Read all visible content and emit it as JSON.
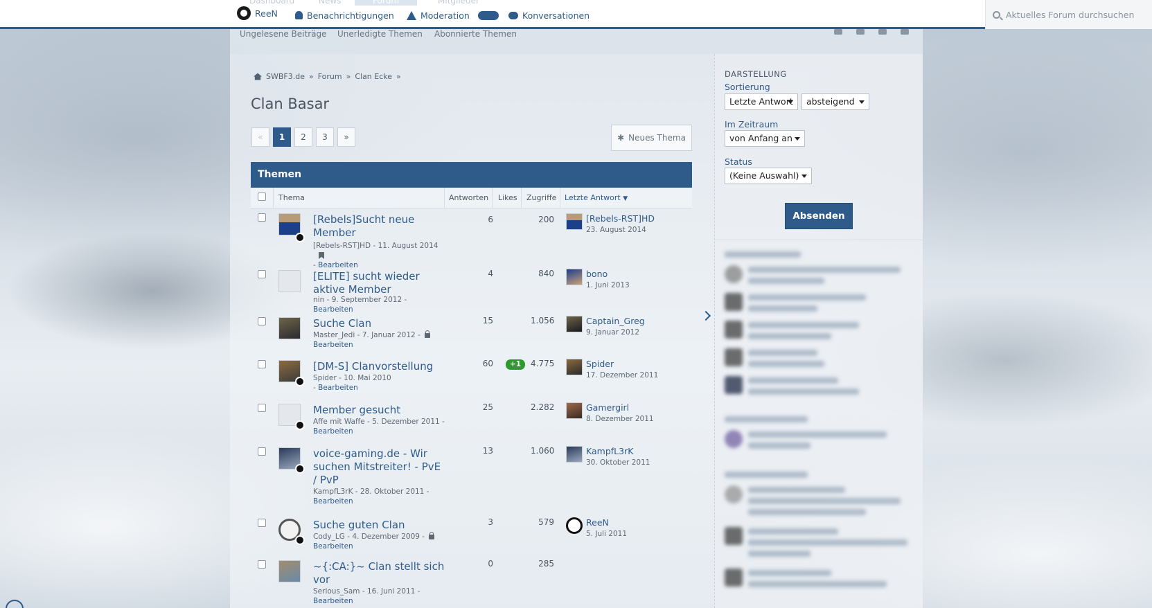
{
  "topbar": {
    "ghost_tabs": [
      "Dashboard",
      "News",
      "Forum",
      "Mitglieder"
    ],
    "user_name": "ReeN",
    "notifications_label": "Benachrichtigungen",
    "moderation_label": "Moderation",
    "conversations_label": "Konversationen",
    "search_placeholder": "Aktuelles Forum durchsuchen"
  },
  "subnav": {
    "links": [
      "Ungelesene Beiträge",
      "Unerledigte Themen",
      "Abonnierte Themen"
    ]
  },
  "breadcrumb": [
    "SWBF3.de",
    "Forum",
    "Clan Ecke"
  ],
  "page_title": "Clan Basar",
  "pager": {
    "prev": "«",
    "pages": [
      "1",
      "2",
      "3"
    ],
    "next": "»",
    "current": "1"
  },
  "new_thread_label": "Neues Thema",
  "panel_title": "Themen",
  "columns": {
    "topic": "Thema",
    "replies": "Antworten",
    "likes": "Likes",
    "views": "Zugriffe",
    "last_reply": "Letzte Antwort"
  },
  "threads": [
    {
      "title": "[Rebels]Sucht neue Member",
      "author": "[Rebels-RST]HD",
      "date": "11. August 2014",
      "edit": "Bearbeiten",
      "replies": "6",
      "likes": "",
      "views": "200",
      "last_user": "[Rebels-RST]HD",
      "last_date": "23. August 2014"
    },
    {
      "title": "[ELITE] sucht wieder aktive Member",
      "author": "nin",
      "date": "9. September 2012",
      "edit": "Bearbeiten",
      "replies": "4",
      "likes": "",
      "views": "840",
      "last_user": "bono",
      "last_date": "1. Juni 2013"
    },
    {
      "title": "Suche Clan",
      "author": "Master_Jedi",
      "date": "7. Januar 2012",
      "edit": "Bearbeiten",
      "replies": "15",
      "likes": "",
      "views": "1.056",
      "last_user": "Captain_Greg",
      "last_date": "9. Januar 2012"
    },
    {
      "title": "[DM-S] Clanvorstellung",
      "author": "Spider",
      "date": "10. Mai 2010",
      "edit": "Bearbeiten",
      "replies": "60",
      "likes": "+1",
      "views": "4.775",
      "last_user": "Spider",
      "last_date": "17. Dezember 2011"
    },
    {
      "title": "Member gesucht",
      "author": "Affe mit Waffe",
      "date": "5. Dezember 2011",
      "edit": "Bearbeiten",
      "replies": "25",
      "likes": "",
      "views": "2.282",
      "last_user": "Gamergirl",
      "last_date": "8. Dezember 2011"
    },
    {
      "title": "voice-gaming.de - Wir suchen Mitstreiter! - PvE / PvP",
      "author": "KampfL3rK",
      "date": "28. Oktober 2011",
      "edit": "Bearbeiten",
      "replies": "13",
      "likes": "",
      "views": "1.060",
      "last_user": "KampfL3rK",
      "last_date": "30. Oktober 2011"
    },
    {
      "title": "Suche guten Clan",
      "author": "Cody_LG",
      "date": "4. Dezember 2009",
      "edit": "Bearbeiten",
      "replies": "3",
      "likes": "",
      "views": "579",
      "last_user": "ReeN",
      "last_date": "5. Juli 2011"
    },
    {
      "title": "~{:CA:}~ Clan stellt sich vor",
      "author": "Serious_Sam",
      "date": "16. Juni 2011",
      "edit": "Bearbeiten",
      "replies": "0",
      "likes": "",
      "views": "285",
      "last_user": "",
      "last_date": ""
    }
  ],
  "sidebar": {
    "section_title": "DARSTELLUNG",
    "sort_label": "Sortierung",
    "sort_field": "Letzte Antwort",
    "sort_order": "absteigend",
    "period_label": "Im Zeitraum",
    "period_value": "von Anfang an",
    "status_label": "Status",
    "status_value": "(Keine Auswahl)",
    "submit_label": "Absenden"
  },
  "colors": {
    "accent": "#2f5b8a",
    "like_badge": "#2d9a2d"
  }
}
